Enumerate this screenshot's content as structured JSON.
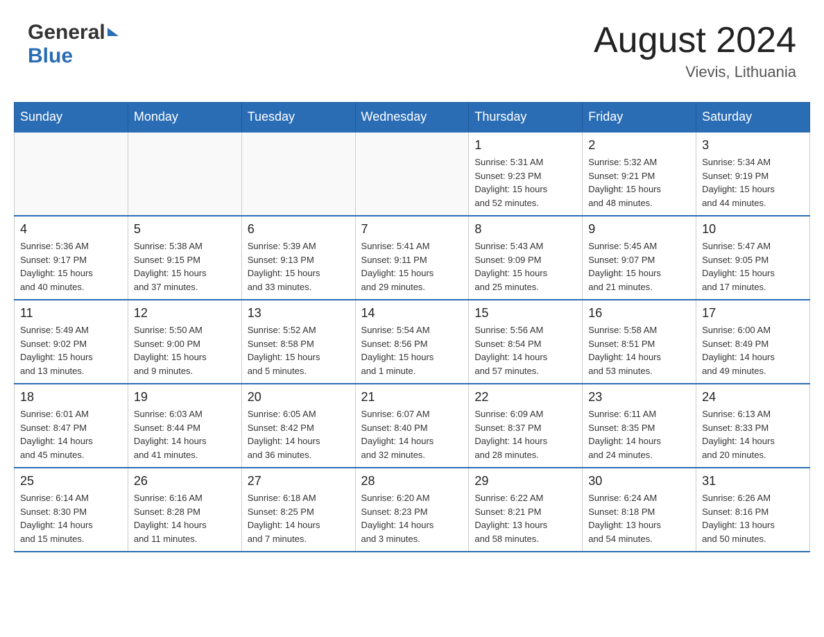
{
  "header": {
    "logo_general": "General",
    "logo_blue": "Blue",
    "title": "August 2024",
    "subtitle": "Vievis, Lithuania"
  },
  "days_of_week": [
    "Sunday",
    "Monday",
    "Tuesday",
    "Wednesday",
    "Thursday",
    "Friday",
    "Saturday"
  ],
  "weeks": [
    [
      {
        "day": "",
        "info": ""
      },
      {
        "day": "",
        "info": ""
      },
      {
        "day": "",
        "info": ""
      },
      {
        "day": "",
        "info": ""
      },
      {
        "day": "1",
        "info": "Sunrise: 5:31 AM\nSunset: 9:23 PM\nDaylight: 15 hours\nand 52 minutes."
      },
      {
        "day": "2",
        "info": "Sunrise: 5:32 AM\nSunset: 9:21 PM\nDaylight: 15 hours\nand 48 minutes."
      },
      {
        "day": "3",
        "info": "Sunrise: 5:34 AM\nSunset: 9:19 PM\nDaylight: 15 hours\nand 44 minutes."
      }
    ],
    [
      {
        "day": "4",
        "info": "Sunrise: 5:36 AM\nSunset: 9:17 PM\nDaylight: 15 hours\nand 40 minutes."
      },
      {
        "day": "5",
        "info": "Sunrise: 5:38 AM\nSunset: 9:15 PM\nDaylight: 15 hours\nand 37 minutes."
      },
      {
        "day": "6",
        "info": "Sunrise: 5:39 AM\nSunset: 9:13 PM\nDaylight: 15 hours\nand 33 minutes."
      },
      {
        "day": "7",
        "info": "Sunrise: 5:41 AM\nSunset: 9:11 PM\nDaylight: 15 hours\nand 29 minutes."
      },
      {
        "day": "8",
        "info": "Sunrise: 5:43 AM\nSunset: 9:09 PM\nDaylight: 15 hours\nand 25 minutes."
      },
      {
        "day": "9",
        "info": "Sunrise: 5:45 AM\nSunset: 9:07 PM\nDaylight: 15 hours\nand 21 minutes."
      },
      {
        "day": "10",
        "info": "Sunrise: 5:47 AM\nSunset: 9:05 PM\nDaylight: 15 hours\nand 17 minutes."
      }
    ],
    [
      {
        "day": "11",
        "info": "Sunrise: 5:49 AM\nSunset: 9:02 PM\nDaylight: 15 hours\nand 13 minutes."
      },
      {
        "day": "12",
        "info": "Sunrise: 5:50 AM\nSunset: 9:00 PM\nDaylight: 15 hours\nand 9 minutes."
      },
      {
        "day": "13",
        "info": "Sunrise: 5:52 AM\nSunset: 8:58 PM\nDaylight: 15 hours\nand 5 minutes."
      },
      {
        "day": "14",
        "info": "Sunrise: 5:54 AM\nSunset: 8:56 PM\nDaylight: 15 hours\nand 1 minute."
      },
      {
        "day": "15",
        "info": "Sunrise: 5:56 AM\nSunset: 8:54 PM\nDaylight: 14 hours\nand 57 minutes."
      },
      {
        "day": "16",
        "info": "Sunrise: 5:58 AM\nSunset: 8:51 PM\nDaylight: 14 hours\nand 53 minutes."
      },
      {
        "day": "17",
        "info": "Sunrise: 6:00 AM\nSunset: 8:49 PM\nDaylight: 14 hours\nand 49 minutes."
      }
    ],
    [
      {
        "day": "18",
        "info": "Sunrise: 6:01 AM\nSunset: 8:47 PM\nDaylight: 14 hours\nand 45 minutes."
      },
      {
        "day": "19",
        "info": "Sunrise: 6:03 AM\nSunset: 8:44 PM\nDaylight: 14 hours\nand 41 minutes."
      },
      {
        "day": "20",
        "info": "Sunrise: 6:05 AM\nSunset: 8:42 PM\nDaylight: 14 hours\nand 36 minutes."
      },
      {
        "day": "21",
        "info": "Sunrise: 6:07 AM\nSunset: 8:40 PM\nDaylight: 14 hours\nand 32 minutes."
      },
      {
        "day": "22",
        "info": "Sunrise: 6:09 AM\nSunset: 8:37 PM\nDaylight: 14 hours\nand 28 minutes."
      },
      {
        "day": "23",
        "info": "Sunrise: 6:11 AM\nSunset: 8:35 PM\nDaylight: 14 hours\nand 24 minutes."
      },
      {
        "day": "24",
        "info": "Sunrise: 6:13 AM\nSunset: 8:33 PM\nDaylight: 14 hours\nand 20 minutes."
      }
    ],
    [
      {
        "day": "25",
        "info": "Sunrise: 6:14 AM\nSunset: 8:30 PM\nDaylight: 14 hours\nand 15 minutes."
      },
      {
        "day": "26",
        "info": "Sunrise: 6:16 AM\nSunset: 8:28 PM\nDaylight: 14 hours\nand 11 minutes."
      },
      {
        "day": "27",
        "info": "Sunrise: 6:18 AM\nSunset: 8:25 PM\nDaylight: 14 hours\nand 7 minutes."
      },
      {
        "day": "28",
        "info": "Sunrise: 6:20 AM\nSunset: 8:23 PM\nDaylight: 14 hours\nand 3 minutes."
      },
      {
        "day": "29",
        "info": "Sunrise: 6:22 AM\nSunset: 8:21 PM\nDaylight: 13 hours\nand 58 minutes."
      },
      {
        "day": "30",
        "info": "Sunrise: 6:24 AM\nSunset: 8:18 PM\nDaylight: 13 hours\nand 54 minutes."
      },
      {
        "day": "31",
        "info": "Sunrise: 6:26 AM\nSunset: 8:16 PM\nDaylight: 13 hours\nand 50 minutes."
      }
    ]
  ]
}
